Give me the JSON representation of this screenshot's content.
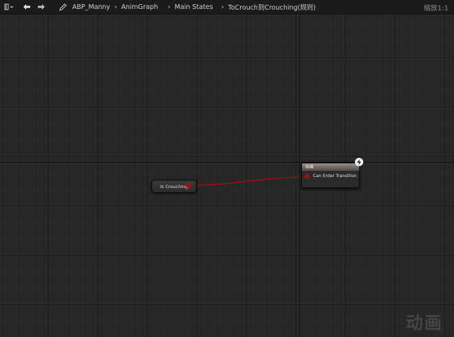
{
  "toolbar": {
    "breadcrumbs": [
      "ABP_Manny",
      "AnimGraph",
      "Main States",
      "ToCrouch到Crouching(规则)"
    ],
    "zoom": "缩放1:1",
    "icons": [
      "graph-menu-icon",
      "back-arrow-icon",
      "forward-arrow-icon",
      "pencil-icon"
    ]
  },
  "graph": {
    "nodes": {
      "is_crouching": {
        "label": "Is Crouching"
      },
      "result": {
        "title": "结果",
        "pin_label": "Can Enter Transition"
      }
    },
    "watermark": "动画"
  },
  "colors": {
    "background": "#262626",
    "bool_pin": "#c00000",
    "wire": "#b01010",
    "result_header": "#8a7f78"
  }
}
